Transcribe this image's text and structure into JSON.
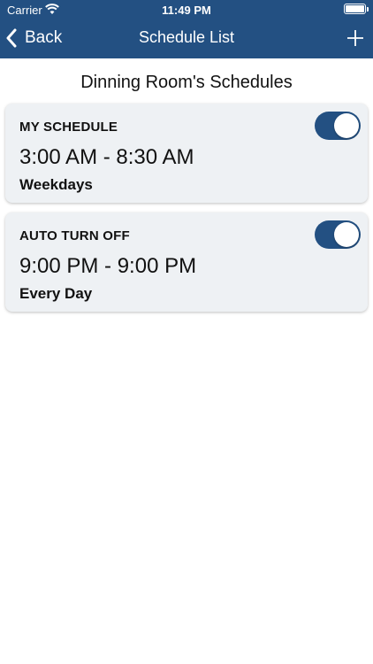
{
  "status_bar": {
    "carrier": "Carrier",
    "time": "11:49 PM",
    "icons": [
      "wifi-icon",
      "battery-icon"
    ]
  },
  "nav": {
    "back_label": "Back",
    "title": "Schedule List",
    "add_icon": "plus-icon",
    "bar_color": "#235082"
  },
  "page": {
    "title": "Dinning Room's Schedules"
  },
  "schedules": [
    {
      "name": "MY SCHEDULE",
      "time": "3:00 AM - 8:30 AM",
      "days": "Weekdays",
      "enabled": true
    },
    {
      "name": "AUTO TURN OFF",
      "time": "9:00 PM - 9:00 PM",
      "days": "Every Day",
      "enabled": true
    }
  ],
  "colors": {
    "accent": "#235082",
    "card_background": "#eef1f4",
    "toggle_knob": "#ffffff"
  }
}
